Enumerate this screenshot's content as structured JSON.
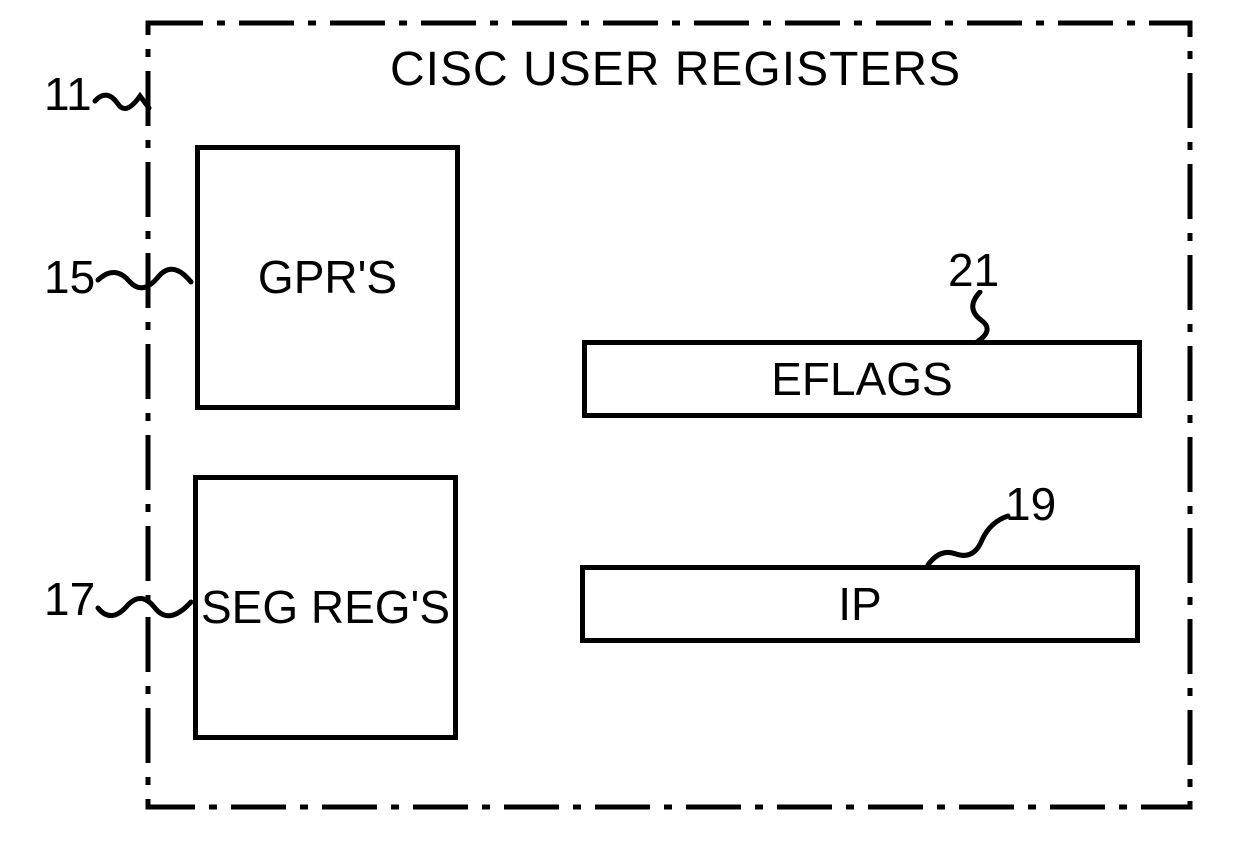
{
  "title": "CISC USER REGISTERS",
  "boxes": {
    "gprs": "GPR'S",
    "seg_regs": "SEG REG'S",
    "eflags": "EFLAGS",
    "ip": "IP"
  },
  "refs": {
    "r11": "11",
    "r15": "15",
    "r17": "17",
    "r19": "19",
    "r21": "21"
  }
}
